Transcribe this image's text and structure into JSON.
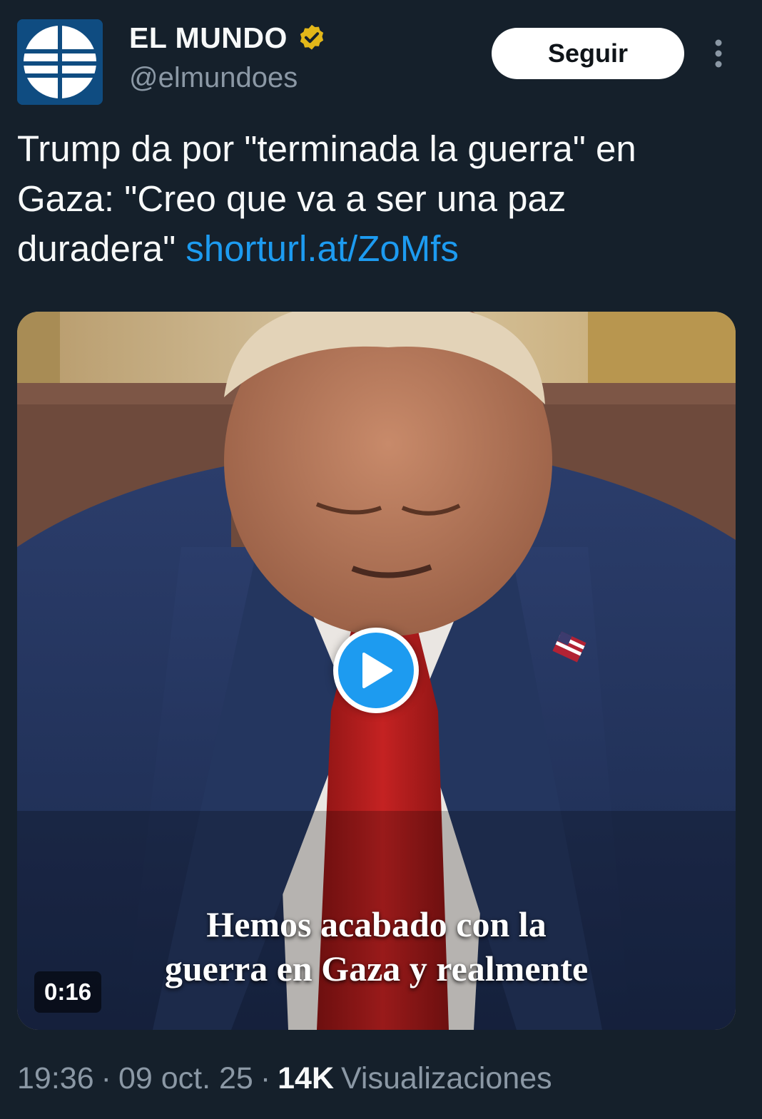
{
  "account": {
    "name": "EL MUNDO",
    "handle": "@elmundoes",
    "verified_color": "#e2b719",
    "avatar_color": "#0f4c81"
  },
  "header": {
    "follow_label": "Seguir",
    "more_icon": "more-vertical-icon"
  },
  "tweet": {
    "text": "Trump da por \"terminada la guerra\" en Gaza: \"Creo que va a ser una paz duradera\"",
    "link": "shorturl.at/ZoMfs"
  },
  "media": {
    "caption_line1": "Hemos acabado con la",
    "caption_line2": "guerra en Gaza y realmente",
    "duration": "0:16",
    "play_icon": "play-icon"
  },
  "meta": {
    "time": "19:36",
    "date": "09 oct. 25",
    "views_count": "14K",
    "views_label": "Visualizaciones"
  },
  "colors": {
    "background": "#15202b",
    "link": "#1d9bf0",
    "secondary_text": "#8b98a5"
  }
}
